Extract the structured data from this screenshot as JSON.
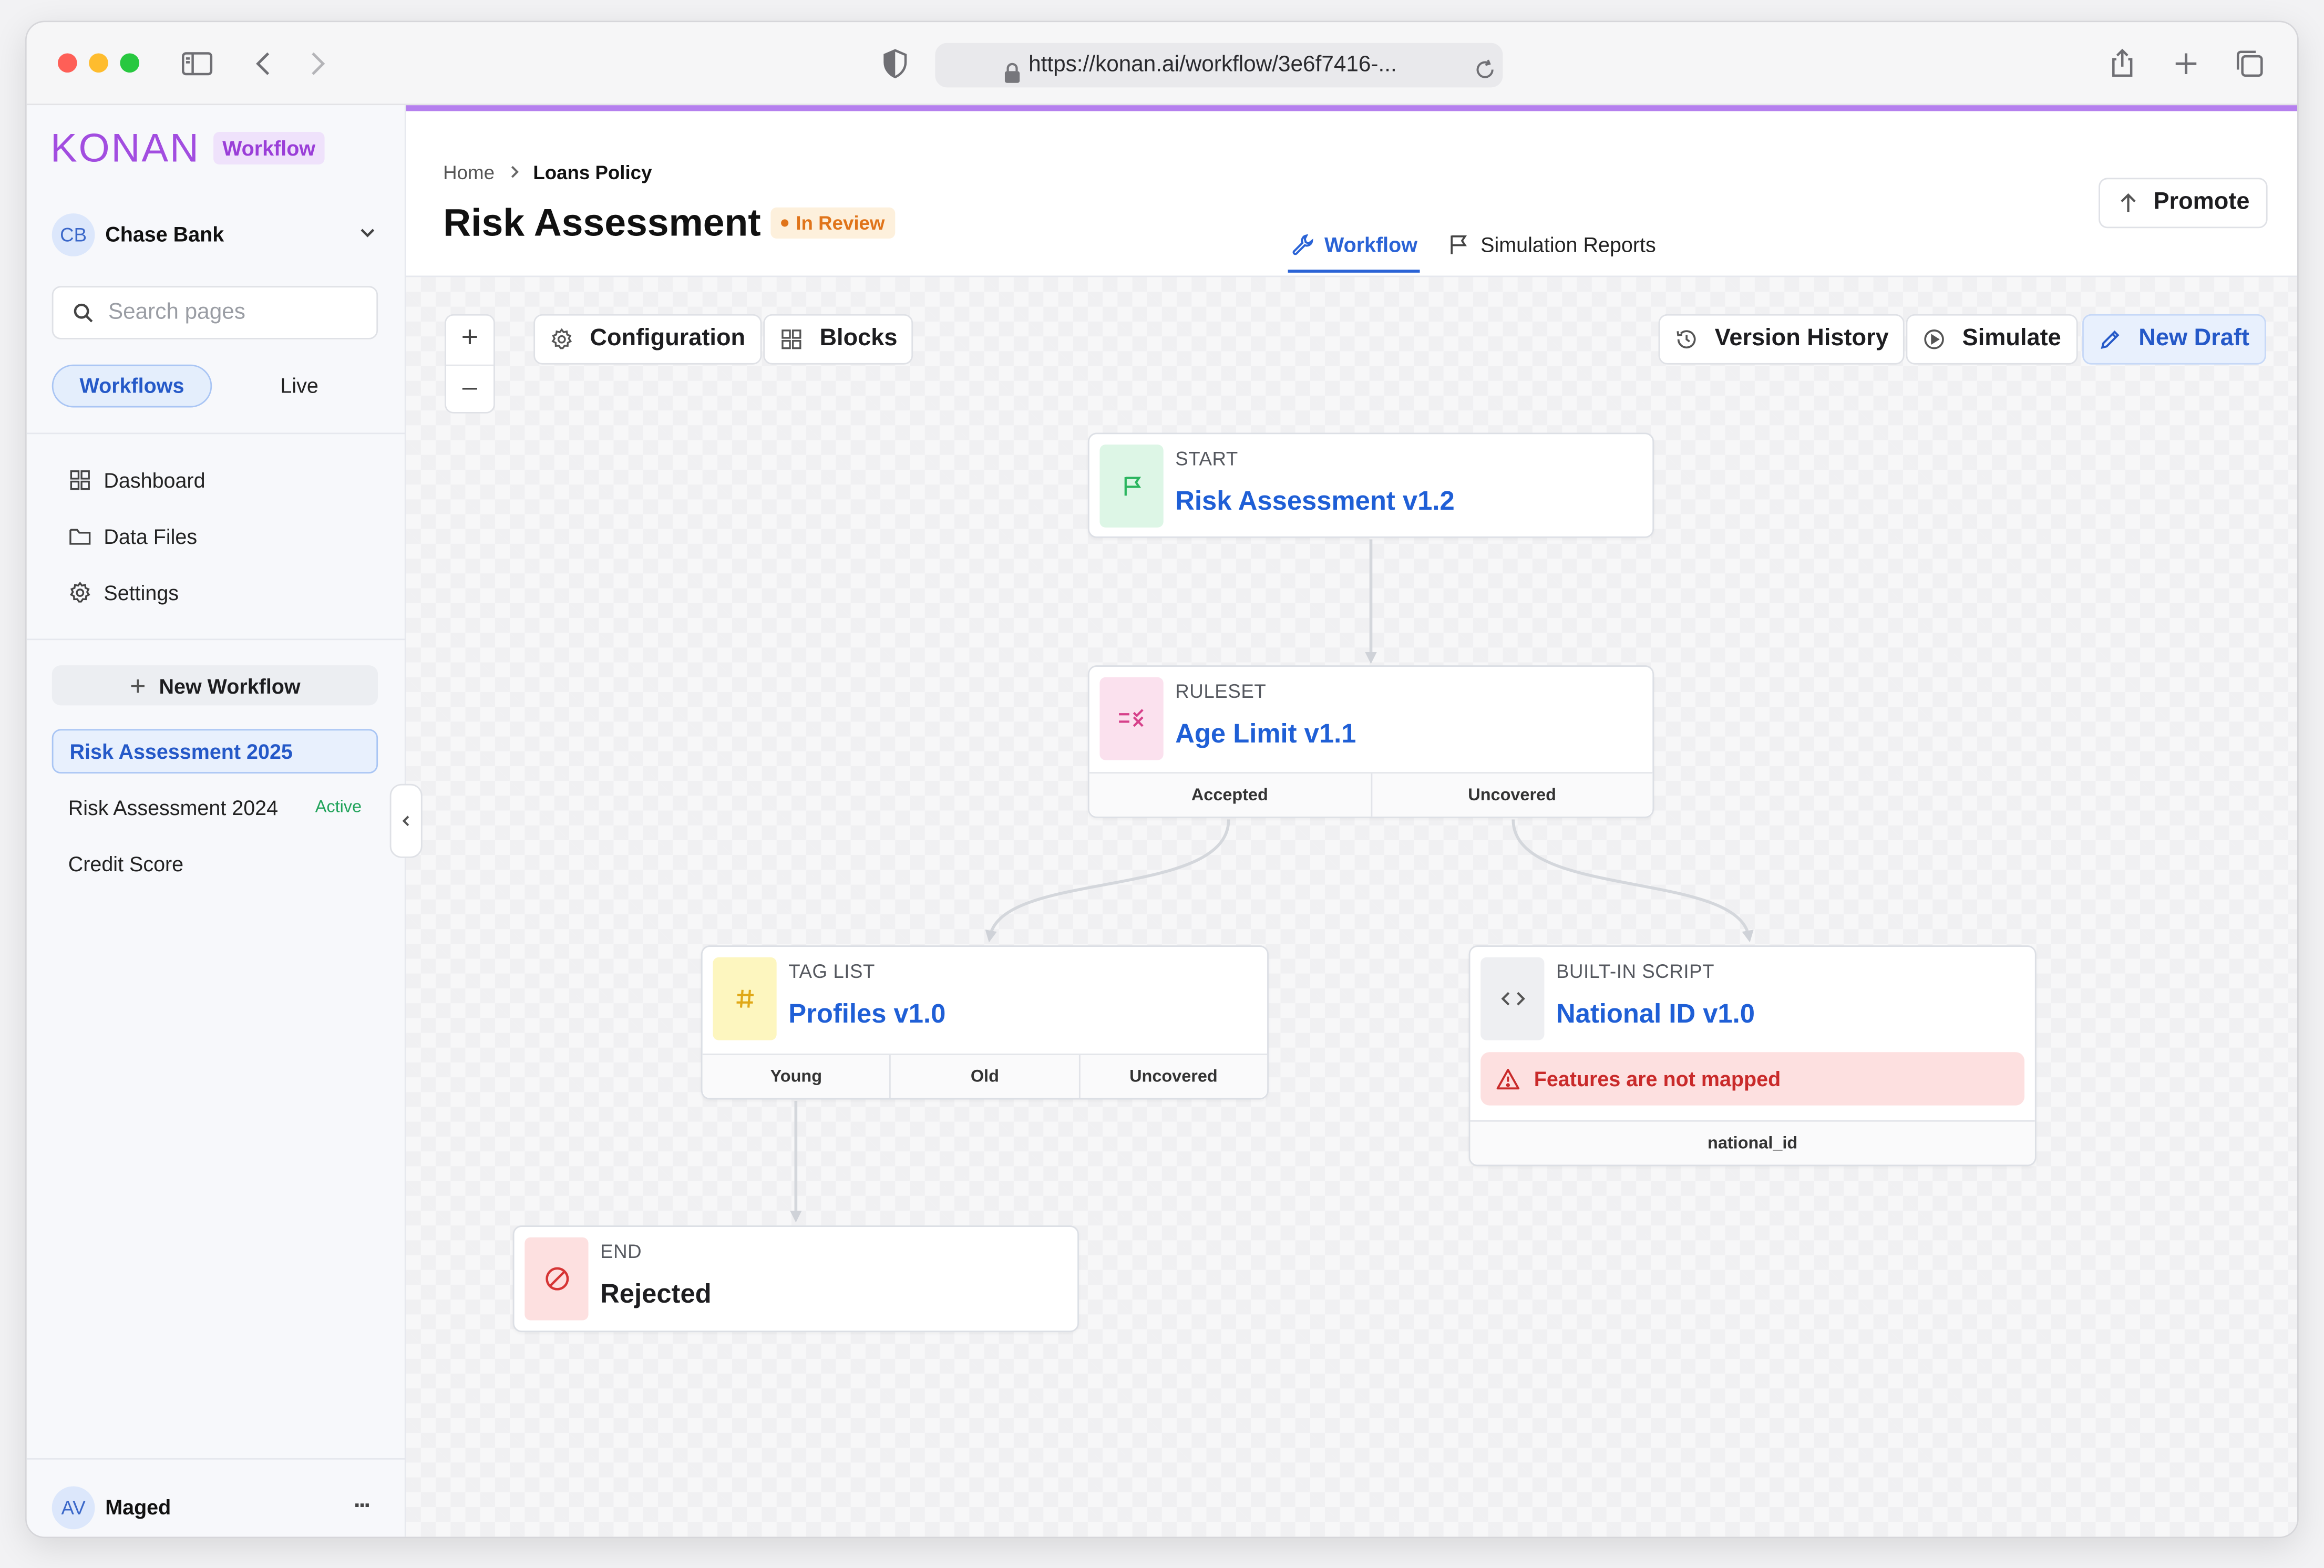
{
  "browser": {
    "url": "https://konan.ai/workflow/3e6f7416-..."
  },
  "sidebar": {
    "brand": "KONAN",
    "brand_tag": "Workflow",
    "org_initials": "CB",
    "org_name": "Chase Bank",
    "search_placeholder": "Search pages",
    "toggle": {
      "workflows": "Workflows",
      "live": "Live"
    },
    "nav": {
      "dashboard": "Dashboard",
      "data_files": "Data Files",
      "settings": "Settings"
    },
    "new_workflow": "New Workflow",
    "workflows": [
      {
        "name": "Risk Assessment 2025",
        "status": ""
      },
      {
        "name": "Risk Assessment 2024",
        "status": "Active"
      },
      {
        "name": "Credit Score",
        "status": ""
      }
    ],
    "user_initials": "AV",
    "user_name": "Maged",
    "more": "..."
  },
  "header": {
    "breadcrumb_home": "Home",
    "breadcrumb_current": "Loans Policy",
    "title": "Risk Assessment",
    "status": "In Review",
    "tabs": {
      "workflow": "Workflow",
      "simulation": "Simulation Reports"
    },
    "promote": "Promote"
  },
  "toolbar": {
    "zoom_in": "+",
    "zoom_out": "–",
    "configuration": "Configuration",
    "blocks": "Blocks",
    "version_history": "Version History",
    "simulate": "Simulate",
    "new_draft": "New Draft"
  },
  "nodes": {
    "start": {
      "kind": "START",
      "title": "Risk Assessment v1.2"
    },
    "ruleset": {
      "kind": "RULESET",
      "title": "Age Limit v1.1",
      "ports": [
        "Accepted",
        "Uncovered"
      ]
    },
    "taglist": {
      "kind": "TAG LIST",
      "title": "Profiles v1.0",
      "ports": [
        "Young",
        "Old",
        "Uncovered"
      ]
    },
    "script": {
      "kind": "BUILT-IN SCRIPT",
      "title": "National ID v1.0",
      "warning": "Features are not mapped",
      "ports": [
        "national_id"
      ]
    },
    "end": {
      "kind": "END",
      "title": "Rejected"
    }
  },
  "colors": {
    "accent": "#b580ee",
    "link": "#1f5fd6",
    "status_review": "#e0741a",
    "active": "#22a35b",
    "warning_bg": "#fde0e0",
    "warning_text": "#c92a2a"
  }
}
